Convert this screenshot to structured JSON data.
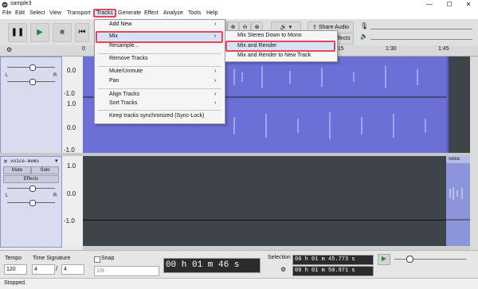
{
  "window": {
    "title": "sample3",
    "controls": [
      "—",
      "☐",
      "✕"
    ]
  },
  "menubar": {
    "items": [
      {
        "label": "File"
      },
      {
        "label": "Edit"
      },
      {
        "label": "Select"
      },
      {
        "label": "View"
      },
      {
        "label": "Transport"
      },
      {
        "label": "Tracks",
        "active": true
      },
      {
        "label": "Generate"
      },
      {
        "label": "Effect"
      },
      {
        "label": "Analyze"
      },
      {
        "label": "Tools"
      },
      {
        "label": "Help"
      }
    ]
  },
  "toolbar": {
    "share_audio": "Share Audio",
    "effects_label": "Effects"
  },
  "ruler": {
    "ticks": [
      "0",
      "1:15",
      "1:30",
      "1:45"
    ]
  },
  "track1": {
    "scale": [
      "0.0",
      "-1.0",
      "1.0",
      "0.0",
      "-1.0"
    ],
    "lr_left": "L",
    "lr_right": "R"
  },
  "track2": {
    "name": "voice-memo",
    "mute": "Mute",
    "solo": "Solo",
    "effects": "Effects",
    "scale": [
      "1.0",
      "0.0",
      "-1.0"
    ],
    "clip_label": "voice",
    "lr_left": "L",
    "lr_right": "R"
  },
  "tracks_menu": {
    "items": [
      {
        "label": "Add New",
        "submenu": true
      },
      {
        "label": "Mix",
        "submenu": true,
        "highlighted": true
      },
      {
        "label": "Resample..."
      },
      {
        "label": "Remove Tracks"
      },
      {
        "label": "Mute/Unmute",
        "submenu": true
      },
      {
        "label": "Pan",
        "submenu": true
      },
      {
        "label": "Align Tracks",
        "submenu": true
      },
      {
        "label": "Sort Tracks",
        "submenu": true
      },
      {
        "label": "Keep tracks synchronized (Sync-Lock)"
      }
    ]
  },
  "mix_submenu": {
    "items": [
      {
        "label": "Mix Stereo Down to Mono"
      },
      {
        "label": "Mix and Render",
        "highlighted": true
      },
      {
        "label": "Mix and Render to New Track"
      }
    ]
  },
  "bottom": {
    "tempo_label": "Tempo",
    "tempo_value": "120",
    "time_sig_label": "Time Signature",
    "time_sig_num": "4",
    "time_sig_den": "4",
    "snap_label": "Snap",
    "snap_value": "1/8",
    "time_display": "00 h 01 m 46 s",
    "selection_label": "Selection",
    "sel_start": "00 h 01 m 45.773 s",
    "sel_end": "00 h 01 m 50.971 s"
  },
  "status": {
    "text": "Stopped."
  },
  "colors": {
    "highlight": "#e9465c",
    "wave": "#6b6fd6",
    "accent": "#2f62c9"
  }
}
